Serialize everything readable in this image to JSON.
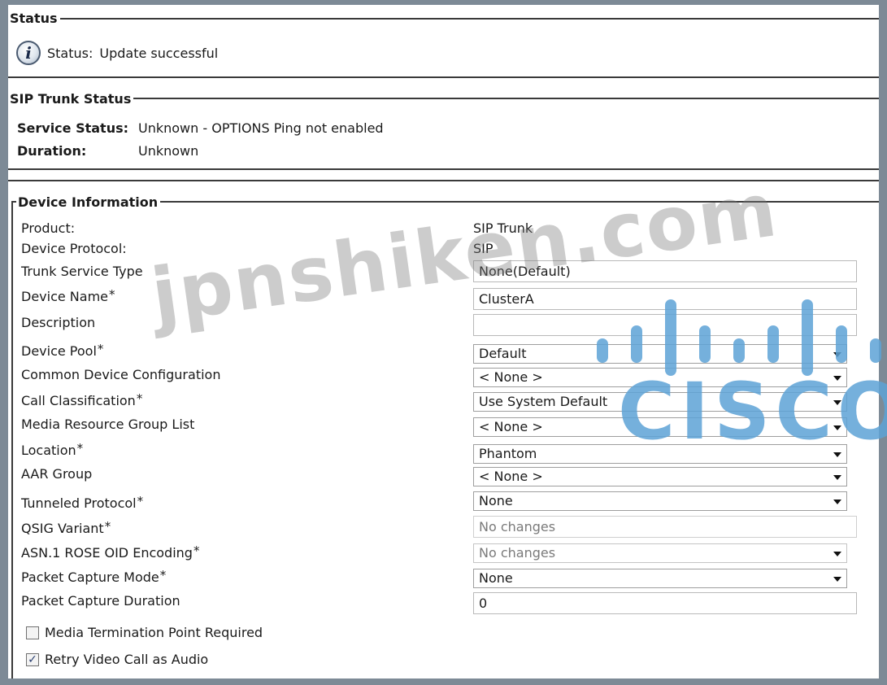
{
  "status": {
    "title": "Status",
    "label": "Status:",
    "message": "Update successful"
  },
  "sip_trunk_status": {
    "title": "SIP Trunk Status",
    "service_status_label": "Service Status:",
    "service_status_value": "Unknown - OPTIONS Ping not enabled",
    "duration_label": "Duration:",
    "duration_value": "Unknown"
  },
  "device_info": {
    "title": "Device Information",
    "product_label": "Product:",
    "product_value": "SIP Trunk",
    "protocol_label": "Device Protocol:",
    "protocol_value": "SIP",
    "trunk_service_type_label": "Trunk Service Type",
    "trunk_service_type_value": "None(Default)",
    "device_name_label": "Device Name",
    "device_name_value": "ClusterA",
    "description_label": "Description",
    "description_value": "",
    "device_pool_label": "Device Pool",
    "device_pool_value": "Default",
    "common_device_config_label": "Common Device Configuration",
    "common_device_config_value": "< None >",
    "call_classification_label": "Call Classification",
    "call_classification_value": "Use System Default",
    "mrgl_label": "Media Resource Group List",
    "mrgl_value": "< None >",
    "location_label": "Location",
    "location_value": "Phantom",
    "aar_group_label": "AAR Group",
    "aar_group_value": "< None >",
    "tunneled_protocol_label": "Tunneled Protocol",
    "tunneled_protocol_value": "None",
    "qsig_variant_label": "QSIG Variant",
    "qsig_variant_value": "No changes",
    "asn1_label": "ASN.1 ROSE OID Encoding",
    "asn1_value": "No changes",
    "packet_capture_mode_label": "Packet Capture Mode",
    "packet_capture_mode_value": "None",
    "packet_capture_duration_label": "Packet Capture Duration",
    "packet_capture_duration_value": "0",
    "mtp_required_label": "Media Termination Point Required",
    "mtp_required_checked": false,
    "retry_video_label": "Retry Video Call as Audio",
    "retry_video_checked": true,
    "required_mark": "*"
  },
  "watermark": {
    "text": "jpnshiken.com",
    "logo_text": "CISCO",
    "logo_color": "#5da2d6"
  },
  "colors": {
    "background": "#7d8a96",
    "panel": "#ffffff",
    "rule": "#3a3a3a"
  }
}
